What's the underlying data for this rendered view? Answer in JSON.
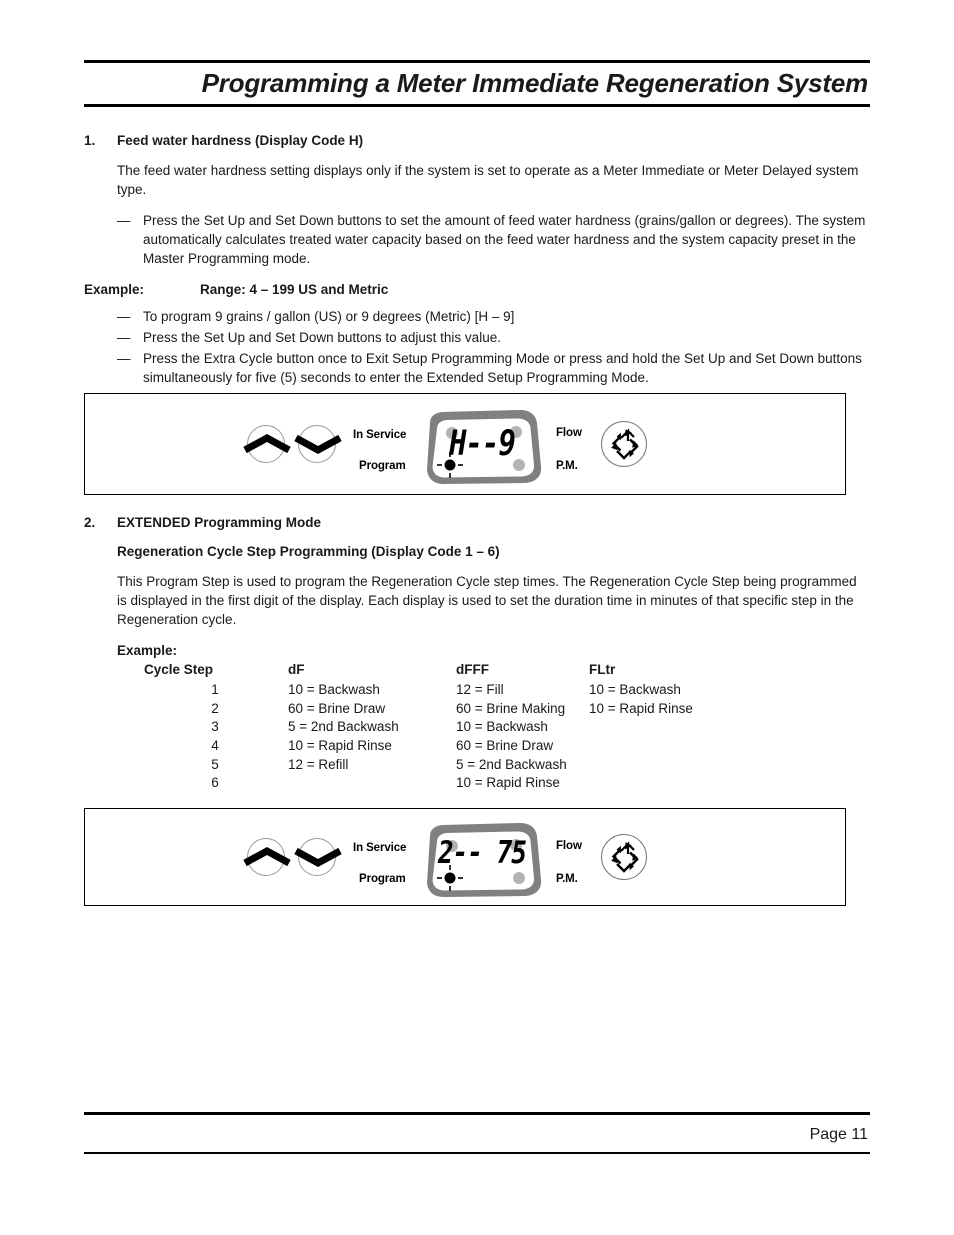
{
  "header": {
    "title": "Programming a Meter Immediate Regeneration System"
  },
  "section1": {
    "number": "1.",
    "heading": "Feed water hardness (Display Code H)",
    "paragraph": "The feed water hardness setting displays only if the system is set to operate as a Meter Immediate or Meter Delayed system type.",
    "bullets": [
      "Press the Set Up and Set Down buttons to set the amount of feed water hardness (grains/gallon or degrees). The system automatically calculates treated water capacity based on the feed water hardness and the system capacity preset in the Master Programming mode."
    ],
    "example_label": "Example:",
    "example_value": "Range: 4 – 199 US and Metric",
    "example_bullets": [
      "To program 9 grains / gallon (US) or 9 degrees (Metric) [H – 9]",
      "Press the Set Up and Set Down buttons to adjust this value.",
      "Press the Extra Cycle button once to Exit Setup Programming Mode or press and hold the Set Up and Set Down buttons simultaneously for five (5) seconds to enter the Extended Setup Programming Mode."
    ]
  },
  "panel1": {
    "display_value": "H--9",
    "labels": {
      "in_service": "In Service",
      "program": "Program",
      "flow": "Flow",
      "pm": "P.M."
    },
    "buttons": {
      "set_up": "set-up-button",
      "set_down": "set-down-button",
      "extra_cycle": "extra-cycle-button"
    },
    "indicators": {
      "in_service_lit": false,
      "program_lit": true,
      "flow_lit": false,
      "pm_lit": false
    }
  },
  "section2": {
    "number": "2.",
    "heading": "EXTENDED Programming Mode",
    "subheading": "Regeneration Cycle Step Programming (Display Code 1 – 6)",
    "paragraph": "This Program Step is used to program the Regeneration Cycle step times. The Regeneration Cycle Step being programmed is displayed in the first digit of the display. Each display is used to set the duration time in minutes of that specific step in the Regeneration cycle.",
    "example_label": "Example:"
  },
  "cycle_table": {
    "headers": [
      "Cycle Step",
      "dF",
      "dFFF",
      "FLtr"
    ],
    "rows": [
      [
        "1",
        "10 = Backwash",
        "12 = Fill",
        "10 = Backwash"
      ],
      [
        "2",
        "60 = Brine Draw",
        "60 = Brine Making",
        "10 = Rapid Rinse"
      ],
      [
        "3",
        "5 = 2nd Backwash",
        "10 = Backwash",
        ""
      ],
      [
        "4",
        "10 = Rapid Rinse",
        "60 = Brine Draw",
        ""
      ],
      [
        "5",
        "12 = Refill",
        "5 = 2nd Backwash",
        ""
      ],
      [
        "6",
        "",
        "10 = Rapid Rinse",
        ""
      ]
    ]
  },
  "panel2": {
    "display_value": "2-- 75",
    "labels": {
      "in_service": "In Service",
      "program": "Program",
      "flow": "Flow",
      "pm": "P.M."
    },
    "indicators": {
      "in_service_lit": false,
      "program_lit": true,
      "flow_lit": false,
      "pm_lit": false
    }
  },
  "footer": {
    "page_label": "Page 11"
  },
  "colors": {
    "bezel": "#808080",
    "lcd_face": "#ffffff",
    "dot_unlit": "#b3b3b3",
    "dot_lit": "#000000",
    "rule": "#000000"
  }
}
